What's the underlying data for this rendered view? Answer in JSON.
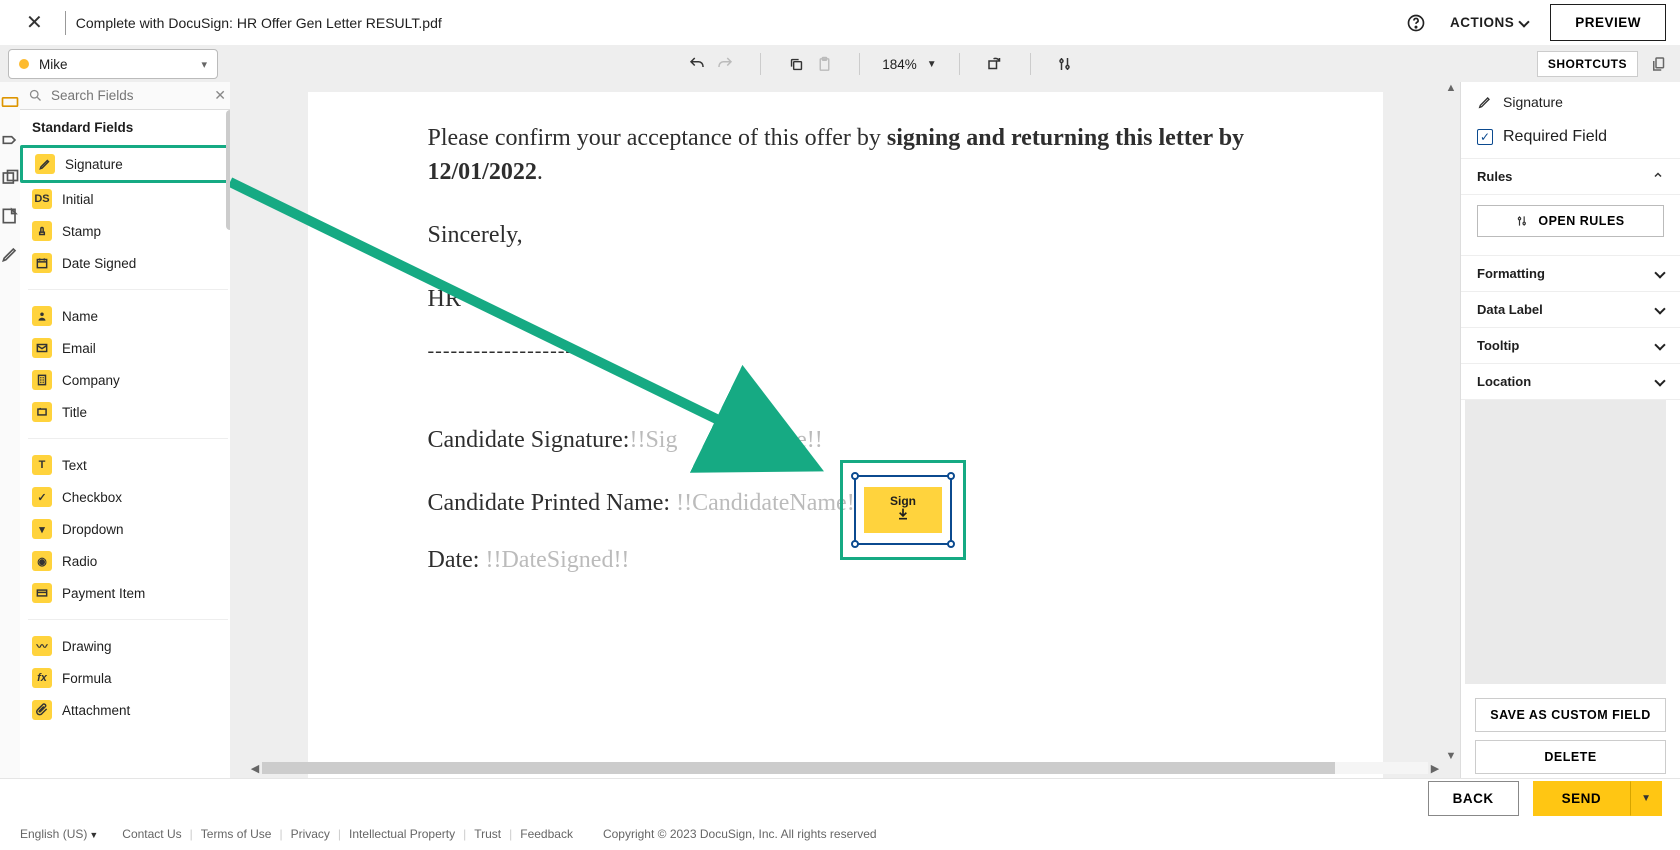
{
  "header": {
    "document_title": "Complete with DocuSign: HR Offer Gen Letter RESULT.pdf",
    "actions_label": "ACTIONS",
    "preview_label": "PREVIEW"
  },
  "recipient": {
    "name": "Mike"
  },
  "toolbar": {
    "zoom": "184%",
    "shortcuts_label": "SHORTCUTS"
  },
  "fields_panel": {
    "search_placeholder": "Search Fields",
    "heading": "Standard Fields",
    "items": [
      {
        "label": "Signature"
      },
      {
        "label": "Initial"
      },
      {
        "label": "Stamp"
      },
      {
        "label": "Date Signed"
      },
      {
        "label": "Name"
      },
      {
        "label": "Email"
      },
      {
        "label": "Company"
      },
      {
        "label": "Title"
      },
      {
        "label": "Text"
      },
      {
        "label": "Checkbox"
      },
      {
        "label": "Dropdown"
      },
      {
        "label": "Radio"
      },
      {
        "label": "Payment Item"
      },
      {
        "label": "Drawing"
      },
      {
        "label": "Formula"
      },
      {
        "label": "Attachment"
      }
    ]
  },
  "doc": {
    "line1_a": "Please confirm your acceptance of this offer by ",
    "line1_b": "signing and returning this letter by 12/01/2022",
    "line1_c": ".",
    "sincerely": "Sincerely,",
    "hr": "HR",
    "dash": "-------------------",
    "cand_sig_label": "Candidate Signature: ",
    "cand_sig_ghost1": "!!Sig",
    "cand_sig_ghost2": "ere!!",
    "cand_pn_label": "Candidate Printed Name: ",
    "cand_pn_ghost": "!!CandidateName!!",
    "date_label": "Date: ",
    "date_ghost": "!!DateSigned!!",
    "sign_box_label": "Sign"
  },
  "right": {
    "field_name": "Signature",
    "required_label": "Required Field",
    "rules_label": "Rules",
    "open_rules_label": "OPEN RULES",
    "formatting_label": "Formatting",
    "data_label_label": "Data Label",
    "tooltip_label": "Tooltip",
    "location_label": "Location",
    "save_custom_label": "SAVE AS CUSTOM FIELD",
    "delete_label": "DELETE"
  },
  "bottom": {
    "back": "BACK",
    "send": "SEND"
  },
  "footer": {
    "lang": "English (US)",
    "links": [
      "Contact Us",
      "Terms of Use",
      "Privacy",
      "Intellectual Property",
      "Trust",
      "Feedback"
    ],
    "copyright": "Copyright © 2023 DocuSign, Inc. All rights reserved"
  }
}
